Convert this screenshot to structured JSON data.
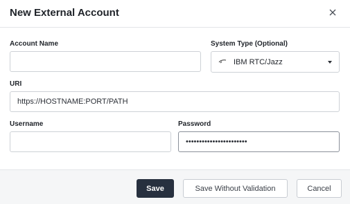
{
  "dialog": {
    "title": "New External Account",
    "close_icon": "close-icon"
  },
  "form": {
    "account_name": {
      "label": "Account Name",
      "value": ""
    },
    "system_type": {
      "label": "System Type (Optional)",
      "selected": "IBM RTC/Jazz",
      "icon": "jazz-logo-icon"
    },
    "uri": {
      "label": "URI",
      "value": "https://HOSTNAME:PORT/PATH"
    },
    "username": {
      "label": "Username",
      "value": ""
    },
    "password": {
      "label": "Password",
      "value": "•••••••••••••••••••••••"
    }
  },
  "footer": {
    "save_label": "Save",
    "save_without_validation_label": "Save Without Validation",
    "cancel_label": "Cancel"
  },
  "colors": {
    "primary_button": "#27303f",
    "footer_bg": "#f5f6f7",
    "border": "#cdd1d6"
  }
}
